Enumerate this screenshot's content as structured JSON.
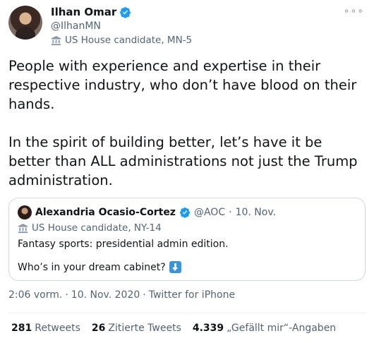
{
  "author": {
    "name": "Ilhan Omar",
    "handle": "@IlhanMN",
    "label": "US House candidate, MN-5"
  },
  "more_icon": "more-dots-icon",
  "tweet_text": "People with experience and expertise in their respective industry, who don’t have blood on their hands.\n\nIn the spirit of building better, let’s have it be better than ALL administrations not just the Trump administration.",
  "quote": {
    "name": "Alexandria Ocasio-Cortez",
    "handle": "@AOC",
    "separator": "·",
    "date": "10. Nov.",
    "label": "US House candidate, NY-14",
    "text_line1": "Fantasy sports: presidential admin edition.",
    "text_line2": "Who’s in your dream cabinet?"
  },
  "meta": {
    "time": "2:06 vorm.",
    "sep1": "·",
    "date": "10. Nov. 2020",
    "sep2": "·",
    "source": "Twitter for iPhone"
  },
  "stats": [
    {
      "num": "281",
      "label": "Retweets"
    },
    {
      "num": "26",
      "label": "Zitierte Tweets"
    },
    {
      "num": "4.339",
      "label": "„Gefällt mir“-Angaben"
    }
  ],
  "colors": {
    "verified": "#1d9bf0",
    "secondary_text": "#536471",
    "border": "#cfd9de"
  }
}
